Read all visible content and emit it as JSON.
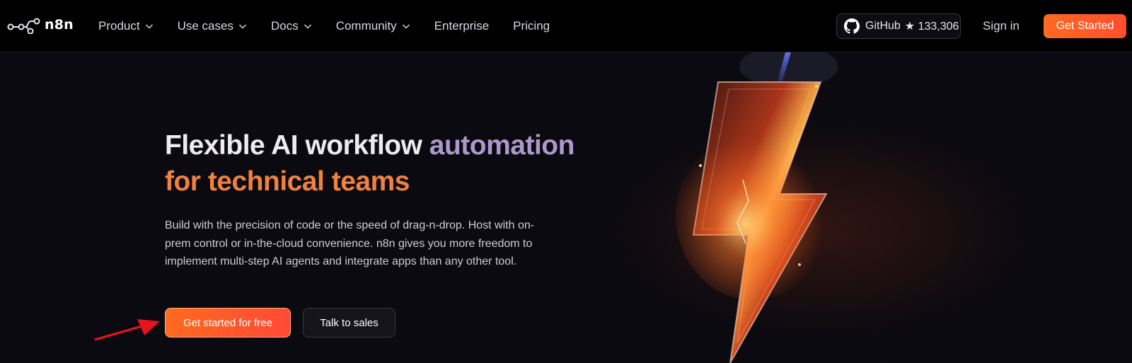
{
  "brand": {
    "name": "n8n"
  },
  "nav": {
    "items": [
      {
        "label": "Product",
        "has_dropdown": true
      },
      {
        "label": "Use cases",
        "has_dropdown": true
      },
      {
        "label": "Docs",
        "has_dropdown": true
      },
      {
        "label": "Community",
        "has_dropdown": true
      },
      {
        "label": "Enterprise",
        "has_dropdown": false
      },
      {
        "label": "Pricing",
        "has_dropdown": false
      }
    ],
    "github": {
      "label": "GitHub",
      "stars": "★ 133,306"
    },
    "sign_in": "Sign in",
    "get_started": "Get Started"
  },
  "hero": {
    "headline_white": "Flexible AI workflow",
    "headline_purple": "automation",
    "headline_orange": "for technical teams",
    "description": "Build with the precision of code or the speed of drag-n-drop. Host with on-prem control or in-the-cloud convenience. n8n gives you more freedom to implement multi-step AI agents and integrate apps than any other tool.",
    "primary_cta": "Get started for free",
    "secondary_cta": "Talk to sales"
  },
  "colors": {
    "accent_orange": "#ff6a1f",
    "headline_purple": "#a99ac9",
    "headline_orange": "#f0813e",
    "annotation_arrow": "#e8141b"
  },
  "icons": {
    "logo": "n8n-nodes-logo-icon",
    "dropdown": "chevron-down-icon",
    "github": "github-icon",
    "annotation": "red-arrow-icon",
    "hero_art": "lightning-bolt-icon"
  }
}
